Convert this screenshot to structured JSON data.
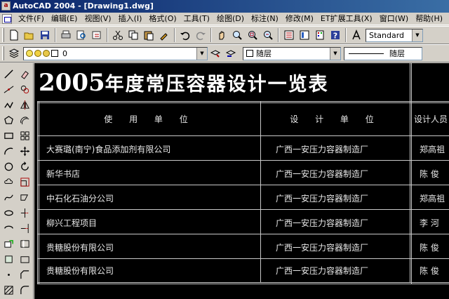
{
  "window": {
    "title": "AutoCAD 2004 - [Drawing1.dwg]",
    "app_icon_glyph": "a"
  },
  "menu": {
    "items": [
      "文件(F)",
      "编辑(E)",
      "视图(V)",
      "插入(I)",
      "格式(O)",
      "工具(T)",
      "绘图(D)",
      "标注(N)",
      "修改(M)",
      "ET扩展工具(X)",
      "窗口(W)"
    ],
    "help": "帮助(H)"
  },
  "toolbar": {
    "text_style": "Standard",
    "layer_name": "0",
    "color_value": "随层",
    "linetype_value": "随层",
    "icons": [
      "new-icon",
      "open-icon",
      "save-icon",
      "print-icon",
      "preview-icon",
      "publish-icon",
      "cut-icon",
      "copy-icon",
      "paste-icon",
      "match-properties-icon",
      "undo-icon",
      "redo-icon",
      "pan-icon",
      "zoom-realtime-icon",
      "zoom-window-icon",
      "zoom-previous-icon",
      "properties-icon",
      "design-center-icon",
      "tool-palette-icon",
      "help-icon",
      "text-style-icon"
    ]
  },
  "colors": {
    "canvas": "#000000",
    "title_bar_start": "#0a246a",
    "title_bar_end": "#3a6ea5",
    "chrome": "#d4d0c8",
    "table_lines": "#c8c8c8"
  },
  "drawing": {
    "title_year": "2005",
    "title_rest": "年度常压容器设计一览表",
    "headers": [
      "使 用 单 位",
      "设 计 单 位",
      "设计人员"
    ],
    "rows": [
      [
        "大赛璐(南宁)食品添加剂有限公司",
        "广西一安压力容器制造厂",
        "郑高祖"
      ],
      [
        "新华书店",
        "广西一安压力容器制造厂",
        "陈 俊"
      ],
      [
        "中石化石油分公司",
        "广西一安压力容器制造厂",
        "郑高祖"
      ],
      [
        "柳兴工程项目",
        "广西一安压力容器制造厂",
        "李 河"
      ],
      [
        "贵糖股份有限公司",
        "广西一安压力容器制造厂",
        "陈 俊"
      ],
      [
        "贵糖股份有限公司",
        "广西一安压力容器制造厂",
        "陈 俊"
      ]
    ]
  }
}
